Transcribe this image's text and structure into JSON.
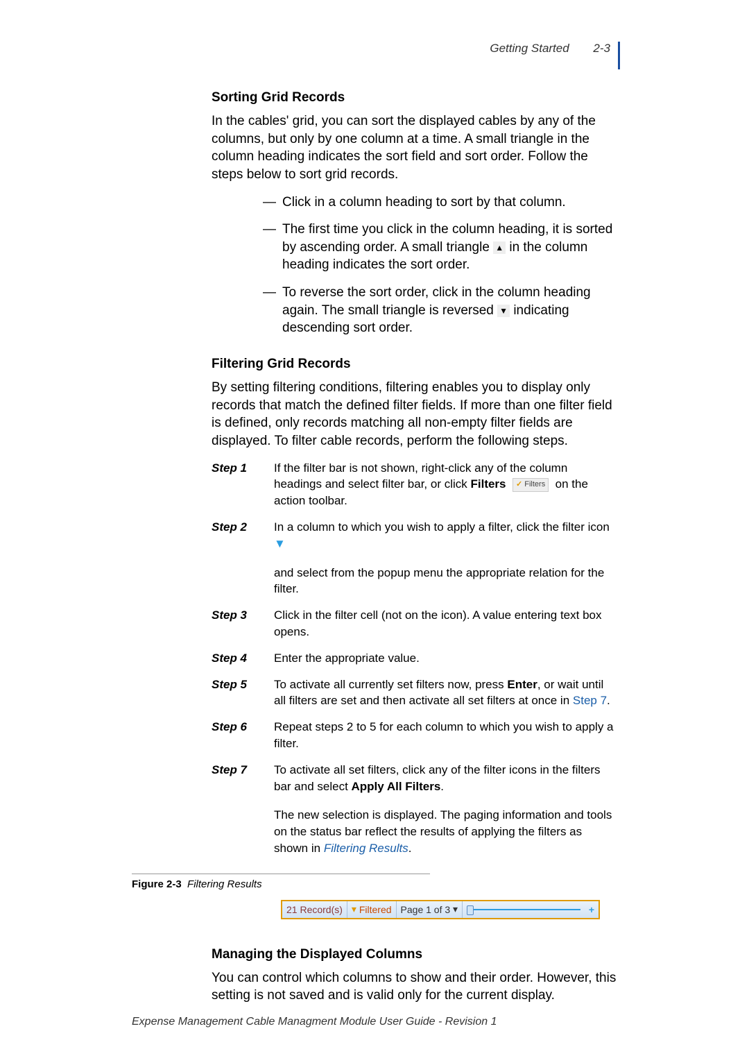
{
  "header": {
    "chapter": "Getting Started",
    "page": "2-3"
  },
  "sorting": {
    "title": "Sorting Grid Records",
    "intro": "In the cables' grid, you can sort the displayed cables by any of the columns, but only by one column at a time. A small triangle in the column heading indicates the sort field and sort order. Follow the steps below to sort grid records.",
    "b1": "Click in a column heading to sort by that column.",
    "b2a": "The first time you click in the column heading, it is sorted by ascending order. A small triangle ",
    "b2b": " in the column heading indicates the sort order.",
    "b3a": "To reverse the sort order, click in the column heading again. The small triangle is reversed ",
    "b3b": " indicating descending sort order.",
    "triUp": "▲",
    "triDown": "▼"
  },
  "filtering": {
    "title": "Filtering Grid Records",
    "intro": "By setting filtering conditions, filtering enables you to display only records that match the defined filter fields. If more than one filter field is defined, only records matching all non-empty filter fields are displayed. To filter cable records, perform the following steps.",
    "steps": {
      "s1l": "Step  1",
      "s1a": "If the filter bar is not shown, right-click any of the column headings and select filter bar, or click ",
      "s1b": "Filters",
      "s1btn": "✓ Filters",
      "s1c": " on the action toolbar.",
      "s2l": "Step  2",
      "s2a": "In a column to which you wish to apply a filter, click the filter icon ",
      "s2b": " and select from the popup menu the appropriate relation for the filter.",
      "s2icon": "▼",
      "s3l": "Step  3",
      "s3": " Click in the filter cell (not on the icon).   A value entering text box opens.",
      "s4l": "Step  4",
      "s4": "Enter the appropriate value.",
      "s5l": "Step  5",
      "s5a": "To activate all currently set filters now, press ",
      "s5b": "Enter",
      "s5c": ", or wait until all filters are set and then activate all set filters at once in ",
      "s5link": "Step 7",
      "s5d": ".",
      "s6l": "Step  6",
      "s6": " Repeat steps 2 to 5 for each column to which you wish to apply a filter.",
      "s7l": "Step  7",
      "s7a": " To activate all set filters, click any of the filter icons in the filters bar and select ",
      "s7b": "Apply All Filters",
      "s7c": ".",
      "s7d": "The new selection is displayed. The paging information and tools on the status bar reflect the results of applying the filters as shown in ",
      "s7link": "Filtering Results",
      "s7e": "."
    }
  },
  "figure": {
    "label": "Figure 2-3",
    "caption": "Filtering Results",
    "records": "21 Record(s)",
    "filtered": "Filtered",
    "page": "Page 1 of 3",
    "plus": "+"
  },
  "managing": {
    "title": "Managing the Displayed Columns",
    "body": "You can control which columns to show and their order. However, this setting is not saved and is valid only for the current display."
  },
  "footer": "Expense Management Cable Managment Module User Guide - Revision 1"
}
